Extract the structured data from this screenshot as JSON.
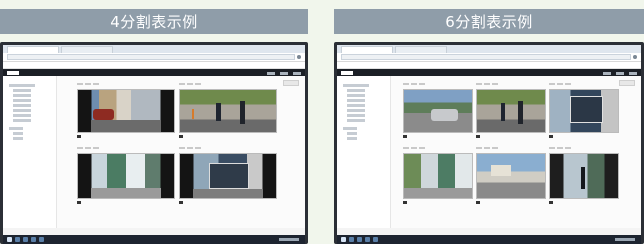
{
  "panels": [
    {
      "title": "4分割表示例"
    },
    {
      "title": "6分割表示例"
    }
  ],
  "colors": {
    "title_bar": "#8f9da9",
    "background": "#f1f6ec",
    "app_header": "#1b1f26"
  }
}
